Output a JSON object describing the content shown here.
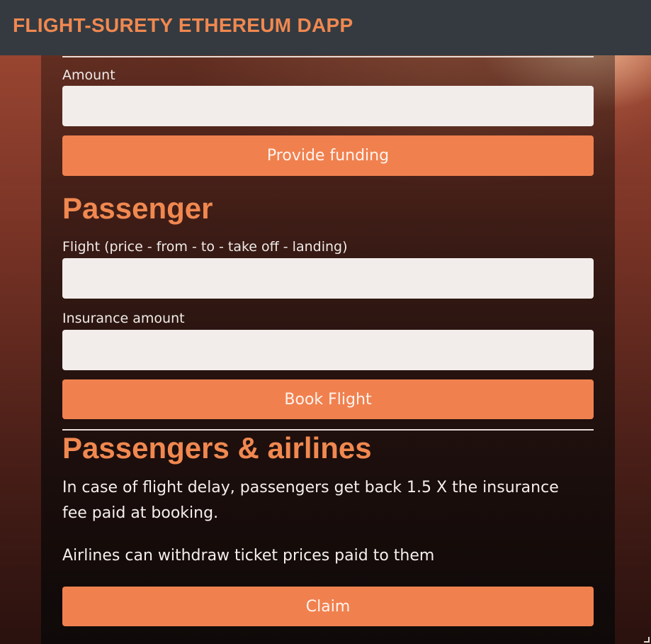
{
  "navbar": {
    "brand": "FLIGHT-SURETY ETHEREUM DAPP"
  },
  "funding": {
    "amount_label": "Amount",
    "amount_value": "",
    "button_label": "Provide funding"
  },
  "passenger": {
    "heading": "Passenger",
    "flight_label": "Flight (price - from - to - take off - landing)",
    "flight_value": "",
    "insurance_label": "Insurance amount",
    "insurance_value": "",
    "button_label": "Book Flight"
  },
  "claims": {
    "heading": "Passengers & airlines",
    "paragraph_1": "In case of flight delay, passengers get back 1.5 X the insurance fee paid at booking.",
    "paragraph_2": "Airlines can withdraw ticket prices paid to them",
    "button_label": "Claim"
  },
  "colors": {
    "accent": "#f0814f",
    "heading": "#f08850",
    "navbar": "#343a40",
    "input_background": "#f2edeb"
  }
}
